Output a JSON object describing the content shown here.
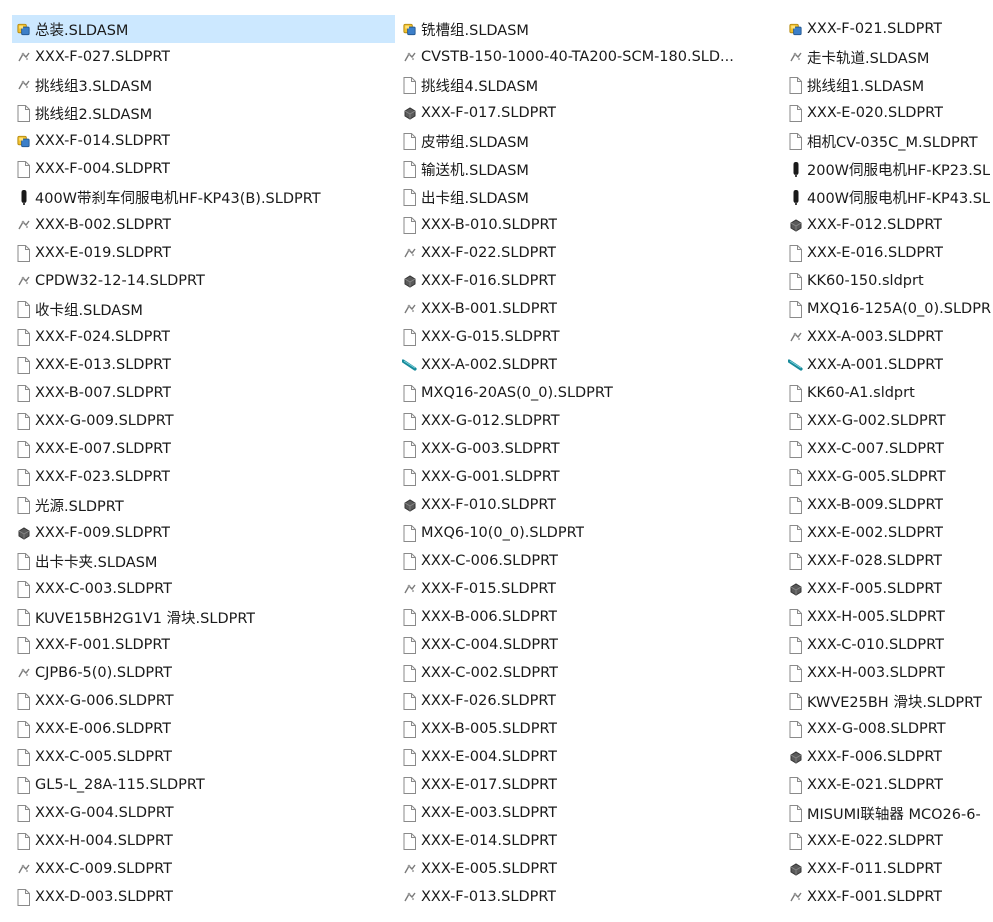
{
  "selected_index": 0,
  "columns": [
    [
      {
        "name": "总装.SLDASM",
        "icon": "assembly-icon"
      },
      {
        "name": "XXX-F-027.SLDPRT",
        "icon": "part-preview-icon"
      },
      {
        "name": "挑线组3.SLDASM",
        "icon": "part-preview-icon"
      },
      {
        "name": "挑线组2.SLDASM",
        "icon": "document-icon"
      },
      {
        "name": "XXX-F-014.SLDPRT",
        "icon": "assembly-icon"
      },
      {
        "name": "XXX-F-004.SLDPRT",
        "icon": "document-icon"
      },
      {
        "name": "400W带刹车伺服电机HF-KP43(B).SLDPRT",
        "icon": "motor-part-icon"
      },
      {
        "name": "XXX-B-002.SLDPRT",
        "icon": "part-preview-icon"
      },
      {
        "name": "XXX-E-019.SLDPRT",
        "icon": "document-icon"
      },
      {
        "name": "CPDW32-12-14.SLDPRT",
        "icon": "part-preview-icon"
      },
      {
        "name": "收卡组.SLDASM",
        "icon": "document-icon"
      },
      {
        "name": "XXX-F-024.SLDPRT",
        "icon": "document-icon"
      },
      {
        "name": "XXX-E-013.SLDPRT",
        "icon": "document-icon"
      },
      {
        "name": "XXX-B-007.SLDPRT",
        "icon": "document-icon"
      },
      {
        "name": "XXX-G-009.SLDPRT",
        "icon": "document-icon"
      },
      {
        "name": "XXX-E-007.SLDPRT",
        "icon": "document-icon"
      },
      {
        "name": "XXX-F-023.SLDPRT",
        "icon": "document-icon"
      },
      {
        "name": "光源.SLDPRT",
        "icon": "document-icon"
      },
      {
        "name": "XXX-F-009.SLDPRT",
        "icon": "block-part-icon"
      },
      {
        "name": "出卡卡夹.SLDASM",
        "icon": "document-icon"
      },
      {
        "name": "XXX-C-003.SLDPRT",
        "icon": "document-icon"
      },
      {
        "name": "KUVE15BH2G1V1 滑块.SLDPRT",
        "icon": "document-icon"
      },
      {
        "name": "XXX-F-001.SLDPRT",
        "icon": "document-icon"
      },
      {
        "name": "CJPB6-5(0).SLDPRT",
        "icon": "part-preview-icon"
      },
      {
        "name": "XXX-G-006.SLDPRT",
        "icon": "document-icon"
      },
      {
        "name": "XXX-E-006.SLDPRT",
        "icon": "document-icon"
      },
      {
        "name": "XXX-C-005.SLDPRT",
        "icon": "document-icon"
      },
      {
        "name": "GL5-L_28A-115.SLDPRT",
        "icon": "document-icon"
      },
      {
        "name": "XXX-G-004.SLDPRT",
        "icon": "document-icon"
      },
      {
        "name": "XXX-H-004.SLDPRT",
        "icon": "document-icon"
      },
      {
        "name": "XXX-C-009.SLDPRT",
        "icon": "part-preview-icon"
      },
      {
        "name": "XXX-D-003.SLDPRT",
        "icon": "document-icon"
      }
    ],
    [
      {
        "name": "铣槽组.SLDASM",
        "icon": "assembly-icon"
      },
      {
        "name": "CVSTB-150-1000-40-TA200-SCM-180.SLD...",
        "icon": "part-preview-icon"
      },
      {
        "name": "挑线组4.SLDASM",
        "icon": "document-icon"
      },
      {
        "name": "XXX-F-017.SLDPRT",
        "icon": "block-part-icon"
      },
      {
        "name": "皮带组.SLDASM",
        "icon": "document-icon"
      },
      {
        "name": "输送机.SLDASM",
        "icon": "document-icon"
      },
      {
        "name": "出卡组.SLDASM",
        "icon": "document-icon"
      },
      {
        "name": "XXX-B-010.SLDPRT",
        "icon": "document-icon"
      },
      {
        "name": "XXX-F-022.SLDPRT",
        "icon": "part-preview-icon"
      },
      {
        "name": "XXX-F-016.SLDPRT",
        "icon": "block-part-icon"
      },
      {
        "name": "XXX-B-001.SLDPRT",
        "icon": "part-preview-icon"
      },
      {
        "name": "XXX-G-015.SLDPRT",
        "icon": "document-icon"
      },
      {
        "name": "XXX-A-002.SLDPRT",
        "icon": "rail-part-icon"
      },
      {
        "name": "MXQ16-20AS(0_0).SLDPRT",
        "icon": "document-icon"
      },
      {
        "name": "XXX-G-012.SLDPRT",
        "icon": "document-icon"
      },
      {
        "name": "XXX-G-003.SLDPRT",
        "icon": "document-icon"
      },
      {
        "name": "XXX-G-001.SLDPRT",
        "icon": "document-icon"
      },
      {
        "name": "XXX-F-010.SLDPRT",
        "icon": "block-part-icon"
      },
      {
        "name": "MXQ6-10(0_0).SLDPRT",
        "icon": "document-icon"
      },
      {
        "name": "XXX-C-006.SLDPRT",
        "icon": "document-icon"
      },
      {
        "name": "XXX-F-015.SLDPRT",
        "icon": "part-preview-icon"
      },
      {
        "name": "XXX-B-006.SLDPRT",
        "icon": "document-icon"
      },
      {
        "name": "XXX-C-004.SLDPRT",
        "icon": "document-icon"
      },
      {
        "name": "XXX-C-002.SLDPRT",
        "icon": "document-icon"
      },
      {
        "name": "XXX-F-026.SLDPRT",
        "icon": "document-icon"
      },
      {
        "name": "XXX-B-005.SLDPRT",
        "icon": "document-icon"
      },
      {
        "name": "XXX-E-004.SLDPRT",
        "icon": "document-icon"
      },
      {
        "name": "XXX-E-017.SLDPRT",
        "icon": "document-icon"
      },
      {
        "name": "XXX-E-003.SLDPRT",
        "icon": "document-icon"
      },
      {
        "name": "XXX-E-014.SLDPRT",
        "icon": "document-icon"
      },
      {
        "name": "XXX-E-005.SLDPRT",
        "icon": "part-preview-icon"
      },
      {
        "name": "XXX-F-013.SLDPRT",
        "icon": "part-preview-icon"
      }
    ],
    [
      {
        "name": "XXX-F-021.SLDPRT",
        "icon": "assembly-icon"
      },
      {
        "name": "走卡轨道.SLDASM",
        "icon": "part-preview-icon"
      },
      {
        "name": "挑线组1.SLDASM",
        "icon": "document-icon"
      },
      {
        "name": "XXX-E-020.SLDPRT",
        "icon": "document-icon"
      },
      {
        "name": "相机CV-035C_M.SLDPRT",
        "icon": "document-icon"
      },
      {
        "name": "200W伺服电机HF-KP23.SL",
        "icon": "motor-part-icon"
      },
      {
        "name": "400W伺服电机HF-KP43.SL",
        "icon": "motor-part-icon"
      },
      {
        "name": "XXX-F-012.SLDPRT",
        "icon": "block-part-icon"
      },
      {
        "name": "XXX-E-016.SLDPRT",
        "icon": "document-icon"
      },
      {
        "name": "KK60-150.sldprt",
        "icon": "document-icon"
      },
      {
        "name": "MXQ16-125A(0_0).SLDPR",
        "icon": "document-icon"
      },
      {
        "name": "XXX-A-003.SLDPRT",
        "icon": "part-preview-icon"
      },
      {
        "name": "XXX-A-001.SLDPRT",
        "icon": "rail-part-icon"
      },
      {
        "name": "KK60-A1.sldprt",
        "icon": "document-icon"
      },
      {
        "name": "XXX-G-002.SLDPRT",
        "icon": "document-icon"
      },
      {
        "name": "XXX-C-007.SLDPRT",
        "icon": "document-icon"
      },
      {
        "name": "XXX-G-005.SLDPRT",
        "icon": "document-icon"
      },
      {
        "name": "XXX-B-009.SLDPRT",
        "icon": "document-icon"
      },
      {
        "name": "XXX-E-002.SLDPRT",
        "icon": "document-icon"
      },
      {
        "name": "XXX-F-028.SLDPRT",
        "icon": "document-icon"
      },
      {
        "name": "XXX-F-005.SLDPRT",
        "icon": "block-part-icon"
      },
      {
        "name": "XXX-H-005.SLDPRT",
        "icon": "document-icon"
      },
      {
        "name": "XXX-C-010.SLDPRT",
        "icon": "document-icon"
      },
      {
        "name": "XXX-H-003.SLDPRT",
        "icon": "document-icon"
      },
      {
        "name": "KWVE25BH 滑块.SLDPRT",
        "icon": "document-icon"
      },
      {
        "name": "XXX-G-008.SLDPRT",
        "icon": "document-icon"
      },
      {
        "name": "XXX-F-006.SLDPRT",
        "icon": "block-part-icon"
      },
      {
        "name": "XXX-E-021.SLDPRT",
        "icon": "document-icon"
      },
      {
        "name": "MISUMI联轴器 MCO26-6-",
        "icon": "document-icon"
      },
      {
        "name": "XXX-E-022.SLDPRT",
        "icon": "document-icon"
      },
      {
        "name": "XXX-F-011.SLDPRT",
        "icon": "block-part-icon"
      },
      {
        "name": "XXX-F-001.SLDPRT",
        "icon": "part-preview-icon"
      }
    ]
  ],
  "colors": {
    "selection": "#cce8ff",
    "assembly_yellow": "#f2c230",
    "assembly_blue": "#3c7fc9",
    "document_outline": "#8a8a8a",
    "part_dark": "#505050",
    "rail_teal": "#178a9a"
  }
}
